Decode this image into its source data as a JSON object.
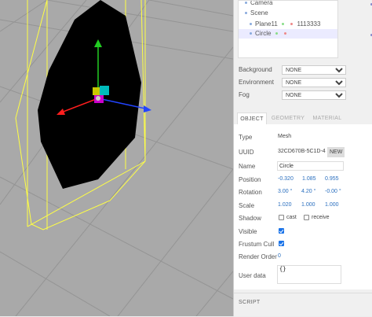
{
  "outliner": {
    "items": [
      {
        "label": "Camera"
      },
      {
        "label": "Scene"
      },
      {
        "label": "Plane11",
        "material": "1113333"
      },
      {
        "label": "Circle"
      }
    ]
  },
  "scene_props": {
    "background": {
      "label": "Background",
      "value": "NONE"
    },
    "environment": {
      "label": "Environment",
      "value": "NONE"
    },
    "fog": {
      "label": "Fog",
      "value": "NONE"
    }
  },
  "tabs": [
    "OBJECT",
    "GEOMETRY",
    "MATERIAL"
  ],
  "object": {
    "type": {
      "label": "Type",
      "value": "Mesh"
    },
    "uuid": {
      "label": "UUID",
      "value": "32CD670B-5C1D-4",
      "button": "NEW"
    },
    "name": {
      "label": "Name",
      "value": "Circle"
    },
    "position": {
      "label": "Position",
      "x": "-0.320",
      "y": "1.085",
      "z": "0.955"
    },
    "rotation": {
      "label": "Rotation",
      "x": "3.00 °",
      "y": "4.20 °",
      "z": "-0.00 °"
    },
    "scale": {
      "label": "Scale",
      "x": "1.020",
      "y": "1.000",
      "z": "1.000"
    },
    "shadow": {
      "label": "Shadow",
      "cast": "cast",
      "receive": "receive"
    },
    "visible": {
      "label": "Visible"
    },
    "frustum": {
      "label": "Frustum Cull"
    },
    "render_order": {
      "label": "Render Order",
      "value": "0"
    },
    "user_data": {
      "label": "User data",
      "value": "{}"
    }
  },
  "script": {
    "title": "SCRIPT"
  },
  "colors": {
    "viewport_bg": "#a9a9a9",
    "grid": "#8f8f8f",
    "selection_box": "#ffff44",
    "mesh": "#000000",
    "axis_x": "#ff1e1e",
    "axis_y": "#22cc22",
    "axis_z": "#2244ff",
    "accent": "#1a73e8"
  }
}
